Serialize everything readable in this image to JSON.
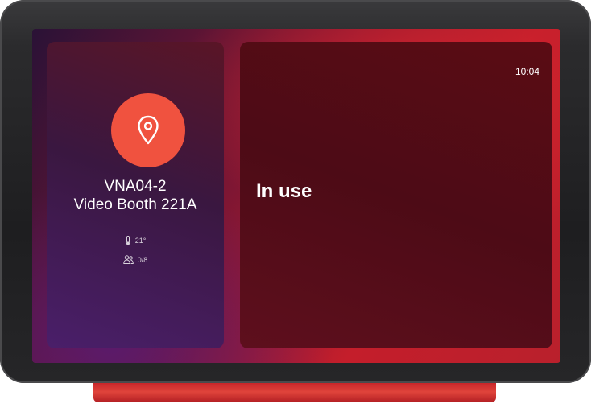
{
  "device": {
    "time": "10:04",
    "status": "In use"
  },
  "room": {
    "code": "VNA04-2",
    "name": "Video Booth 221A",
    "temperature": "21°",
    "occupancy": "0/8",
    "icons": {
      "location": "map-pin-icon",
      "temperature": "thermometer-icon",
      "occupancy": "people-icon"
    }
  },
  "colors": {
    "accent": "#f0523f",
    "stand": "#d4302f"
  }
}
